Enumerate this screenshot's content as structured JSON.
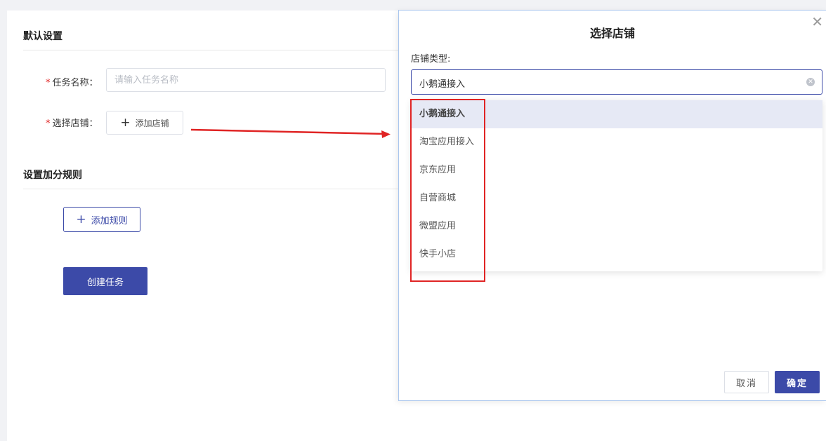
{
  "form": {
    "section_default": "默认设置",
    "task_name": {
      "required_mark": "*",
      "label": "任务名称：",
      "placeholder": "请输入任务名称",
      "value": ""
    },
    "store": {
      "required_mark": "*",
      "label": "选择店铺：",
      "add_button": "添加店铺"
    },
    "section_rules": "设置加分规则",
    "add_rule_button": "添加规则",
    "create_button": "创建任务"
  },
  "modal": {
    "title": "选择店铺",
    "close_icon": "close-icon",
    "store_type_label": "店铺类型:",
    "selected_value": "小鹅通接入",
    "options": [
      {
        "label": "小鹅通接入",
        "selected": true
      },
      {
        "label": "淘宝应用接入",
        "selected": false
      },
      {
        "label": "京东应用",
        "selected": false
      },
      {
        "label": "自营商城",
        "selected": false
      },
      {
        "label": "微盟应用",
        "selected": false
      },
      {
        "label": "快手小店",
        "selected": false
      }
    ],
    "cancel_button": "取消",
    "confirm_button": "确定"
  },
  "colors": {
    "primary": "#3c4aa8",
    "annotation_red": "#e02424",
    "selected_option_bg": "#e6e9f5"
  }
}
